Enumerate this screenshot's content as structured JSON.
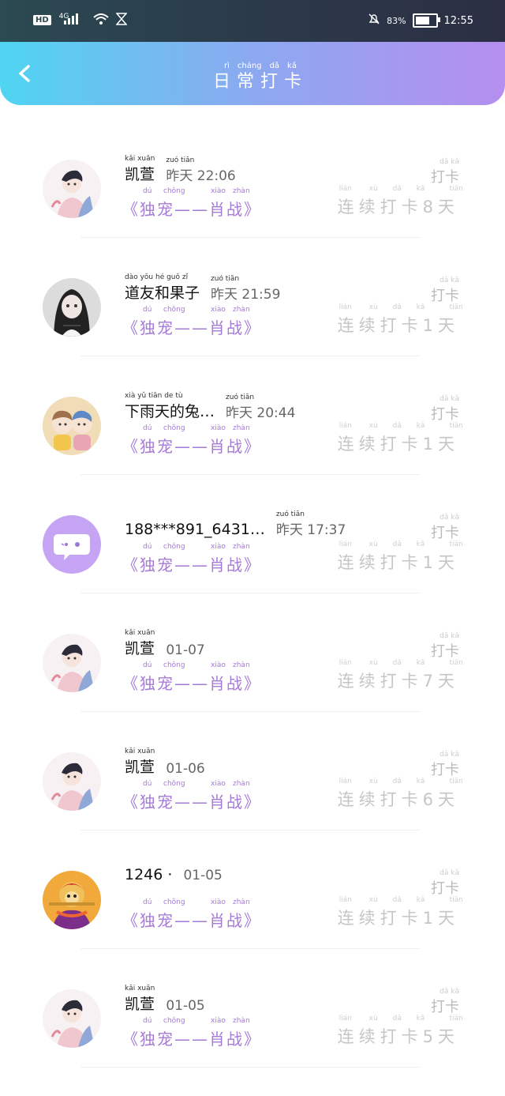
{
  "status_bar": {
    "hd": "HD",
    "signal": "4G",
    "battery": "83%",
    "time": "12:55",
    "battery_level": 0.83
  },
  "header": {
    "title": "日常打卡",
    "pinyin": [
      "rì",
      "cháng",
      "dǎ",
      "kǎ"
    ]
  },
  "checkin_label": "打卡",
  "checkin_pinyin": [
    "dǎ",
    "kǎ"
  ],
  "book": "《独宠——肖战》",
  "book_pinyin": [
    "dú",
    "chǒng",
    "xiào",
    "zhàn"
  ],
  "streak_pinyin": [
    "lián",
    "xù",
    "dǎ",
    "kǎ",
    "tiān"
  ],
  "items": [
    {
      "name": "凯萱",
      "name_py": "kǎi xuān",
      "time": "昨天 22:06",
      "time_py": "zuó tiān",
      "streak": "连续打卡8天",
      "avatar": "anime-boy"
    },
    {
      "name": "道友和果子",
      "name_py": "dào yǒu hé guǒ zǐ",
      "time": "昨天 21:59",
      "time_py": "zuó tiān",
      "streak": "连续打卡1天",
      "avatar": "girl-photo"
    },
    {
      "name": "下雨天的兔…",
      "name_py": "xià yǔ tiān de tù",
      "time": "昨天 20:44",
      "time_py": "zuó tiān",
      "streak": "连续打卡1天",
      "avatar": "cartoon-kids"
    },
    {
      "name": "188***891_6431…",
      "name_py": "",
      "time": "昨天 17:37",
      "time_py": "zuó tiān",
      "streak": "连续打卡1天",
      "avatar": "chat-bubble"
    },
    {
      "name": "凯萱",
      "name_py": "kǎi xuān",
      "time": "01-07",
      "time_py": "",
      "streak": "连续打卡7天",
      "avatar": "anime-boy"
    },
    {
      "name": "凯萱",
      "name_py": "kǎi xuān",
      "time": "01-06",
      "time_py": "",
      "streak": "连续打卡6天",
      "avatar": "anime-boy"
    },
    {
      "name": "1246 ·",
      "name_py": "",
      "time": "01-05",
      "time_py": "",
      "streak": "连续打卡1天",
      "avatar": "monkey-king"
    },
    {
      "name": "凯萱",
      "name_py": "kǎi xuān",
      "time": "01-05",
      "time_py": "",
      "streak": "连续打卡5天",
      "avatar": "anime-boy"
    }
  ]
}
